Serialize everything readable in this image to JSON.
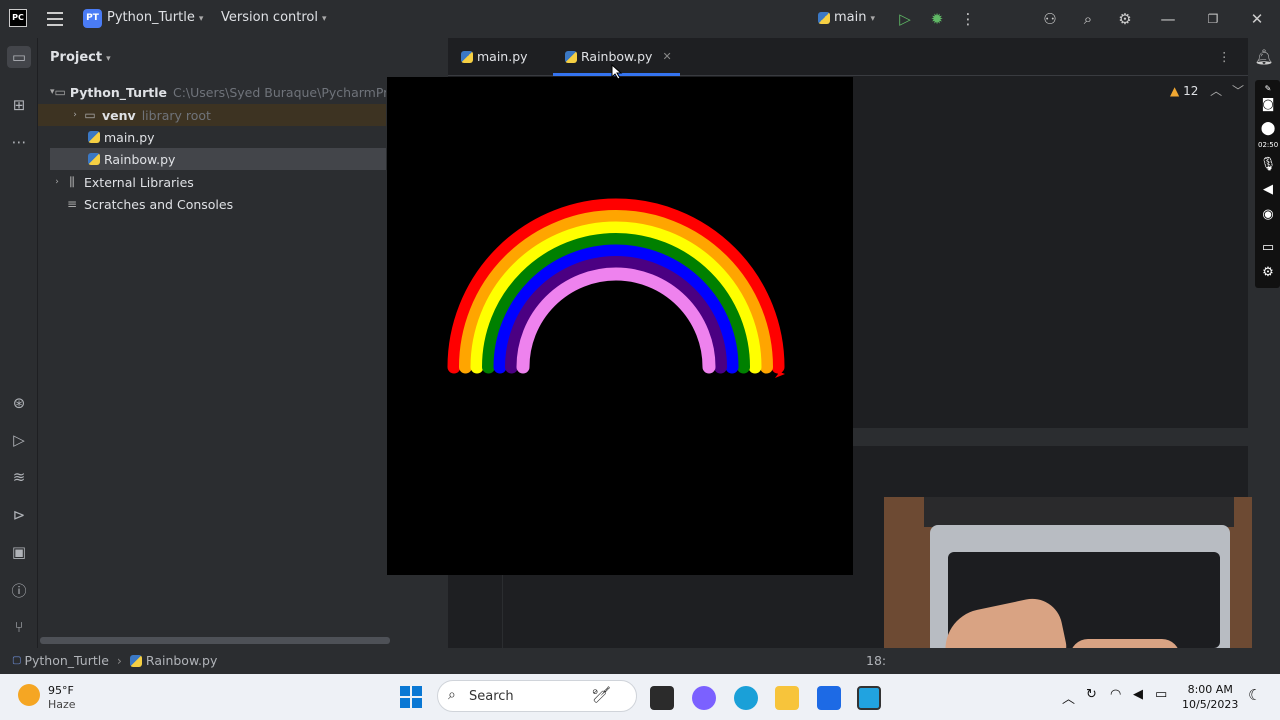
{
  "titlebar": {
    "logo": "PC",
    "project_badge": "PT",
    "project_name": "Python_Turtle",
    "version_control": "Version control",
    "branch": "main"
  },
  "project_panel": {
    "header": "Project",
    "tree": [
      {
        "label": "Python_Turtle",
        "hint": "C:\\Users\\Syed Buraque\\PycharmPro",
        "icon": "folder-icon"
      },
      {
        "label": "venv",
        "hint": "library root",
        "icon": "folder-icon"
      },
      {
        "label": "main.py",
        "hint": "",
        "icon": "python-file-icon"
      },
      {
        "label": "Rainbow.py",
        "hint": "",
        "icon": "python-file-icon"
      },
      {
        "label": "External Libraries",
        "hint": "",
        "icon": "library-icon"
      },
      {
        "label": "Scratches and Consoles",
        "hint": "",
        "icon": "scratches-icon"
      }
    ]
  },
  "editor": {
    "tabs": [
      {
        "label": "main.py",
        "active": false
      },
      {
        "label": "Rainbow.py",
        "active": true
      }
    ],
    "warning_count": "12"
  },
  "overlay": {
    "timer": "02:50"
  },
  "statusbar": {
    "breadcrumb": [
      "Python_Turtle",
      "Rainbow.py"
    ],
    "position": "18:"
  },
  "rainbow": {
    "colors": [
      "#ff0000",
      "#ffa500",
      "#ffff00",
      "#008000",
      "#0000ff",
      "#4b0082",
      "#ee82ee"
    ]
  },
  "taskbar": {
    "weather_temp": "95°F",
    "weather_desc": "Haze",
    "search_placeholder": "Search",
    "time": "8:00 AM",
    "date": "10/5/2023"
  }
}
